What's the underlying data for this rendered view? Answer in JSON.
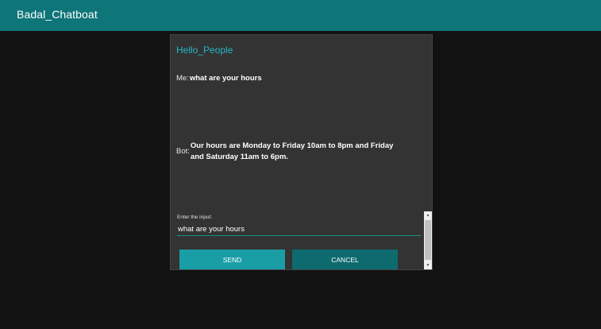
{
  "app": {
    "title": "Badal_Chatboat",
    "accent_color": "#0e7579"
  },
  "chat": {
    "heading": "Hello_People",
    "messages": [
      {
        "speaker": "Me:",
        "text": "what are your hours"
      },
      {
        "speaker": "Bot:",
        "text": "Our hours are Monday to Friday 10am to 8pm and Friday and Saturday 11am to 6pm."
      }
    ]
  },
  "input": {
    "label": "Enter the input:",
    "value": "what are your hours"
  },
  "buttons": {
    "send_label": "SEND",
    "cancel_label": "CANCEL"
  },
  "scrollbar": {
    "up_icon": "triangle-up",
    "down_icon": "triangle-down"
  }
}
